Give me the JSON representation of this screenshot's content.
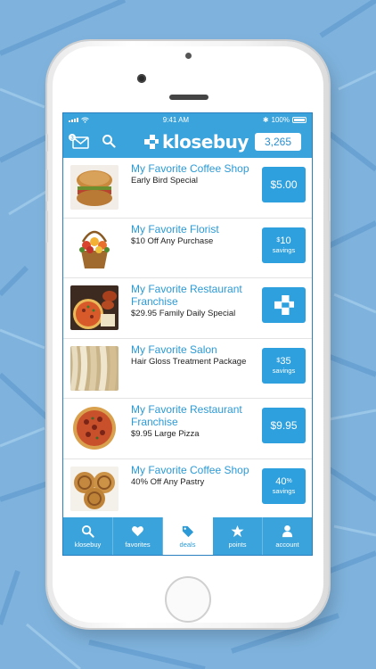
{
  "status_bar": {
    "time": "9:41 AM",
    "battery": "100%"
  },
  "header": {
    "logo_text": "klosebuy",
    "points": "3,265"
  },
  "deals": [
    {
      "title": "My Favorite Coffee Shop",
      "subtitle": "Early Bird Special",
      "button": {
        "type": "price",
        "price": "$5.00"
      },
      "image": "bagel-sandwich"
    },
    {
      "title": "My Favorite Florist",
      "subtitle": "$10 Off Any Purchase",
      "button": {
        "type": "savings",
        "currency": "$",
        "amount": "10",
        "label": "savings"
      },
      "image": "flower-basket"
    },
    {
      "title": "My Favorite Restaurant Franchise",
      "subtitle": "$29.95 Family Daily Special",
      "button": {
        "type": "logo"
      },
      "image": "pizza-wings"
    },
    {
      "title": "My Favorite Salon",
      "subtitle": "Hair Gloss Treatment Package",
      "button": {
        "type": "savings",
        "currency": "$",
        "amount": "35",
        "label": "savings"
      },
      "image": "hair"
    },
    {
      "title": "My Favorite Restaurant Franchise",
      "subtitle": "$9.95 Large Pizza",
      "button": {
        "type": "price",
        "price": "$9.95"
      },
      "image": "pizza"
    },
    {
      "title": "My Favorite Coffee Shop",
      "subtitle": "40% Off Any Pastry",
      "button": {
        "type": "savings",
        "amount": "40",
        "unit": "%",
        "label": "savings"
      },
      "image": "cinnamon-rolls"
    }
  ],
  "tabs": [
    {
      "label": "klosebuy",
      "icon": "search-icon",
      "active": false
    },
    {
      "label": "favorites",
      "icon": "heart-icon",
      "active": false
    },
    {
      "label": "deals",
      "icon": "tag-icon",
      "active": true
    },
    {
      "label": "points",
      "icon": "star-icon",
      "active": false
    },
    {
      "label": "account",
      "icon": "person-icon",
      "active": false
    }
  ],
  "colors": {
    "brand": "#3aa3dc",
    "button": "#2fa0de",
    "title": "#2b9ad6",
    "background": "#7fb3dd"
  }
}
